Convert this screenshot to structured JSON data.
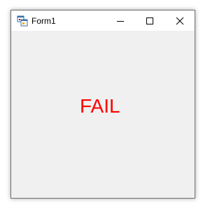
{
  "window": {
    "title": "Form1",
    "app_icon": "form-app-icon",
    "controls": {
      "minimize_icon": "minimize-icon",
      "maximize_icon": "maximize-icon",
      "close_icon": "close-icon"
    }
  },
  "client": {
    "label_text": "FAIL",
    "label_color": "#ff0000",
    "background_color": "#f0f0f0"
  }
}
